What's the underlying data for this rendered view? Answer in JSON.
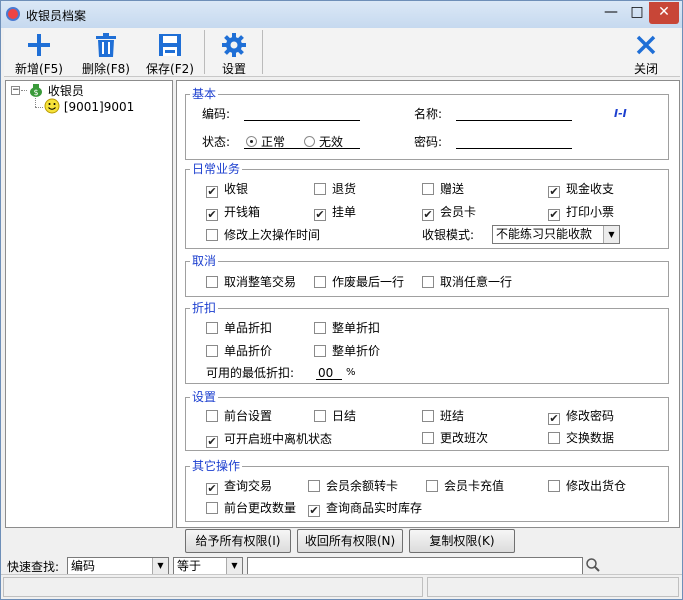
{
  "window": {
    "title": "收银员档案"
  },
  "toolbar": {
    "add_label": "新增(F5)",
    "delete_label": "删除(F8)",
    "save_label": "保存(F2)",
    "settings_label": "设置",
    "close_label": "关闭"
  },
  "tree": {
    "root_label": "收银员",
    "child_label": "[9001]9001"
  },
  "basic": {
    "title": "基本",
    "code_label": "编码:",
    "name_label": "名称:",
    "status_label": "状态:",
    "status_normal": "正常",
    "status_invalid": "无效",
    "password_label": "密码:",
    "marker": "I-I"
  },
  "daily": {
    "title": "日常业务",
    "items": [
      {
        "label": "收银",
        "checked": true
      },
      {
        "label": "退货",
        "checked": false
      },
      {
        "label": "赠送",
        "checked": false
      },
      {
        "label": "现金收支",
        "checked": true
      },
      {
        "label": "开钱箱",
        "checked": true
      },
      {
        "label": "挂单",
        "checked": true
      },
      {
        "label": "会员卡",
        "checked": true
      },
      {
        "label": "打印小票",
        "checked": true
      },
      {
        "label": "修改上次操作时间",
        "checked": false
      }
    ],
    "mode_label": "收银模式:",
    "mode_value": "不能练习只能收款"
  },
  "cancel": {
    "title": "取消",
    "items": [
      {
        "label": "取消整笔交易",
        "checked": false
      },
      {
        "label": "作废最后一行",
        "checked": false
      },
      {
        "label": "取消任意一行",
        "checked": false
      }
    ]
  },
  "discount": {
    "title": "折扣",
    "items": [
      {
        "label": "单品折扣",
        "checked": false
      },
      {
        "label": "整单折扣",
        "checked": false
      },
      {
        "label": "单品折价",
        "checked": false
      },
      {
        "label": "整单折价",
        "checked": false
      }
    ],
    "min_label": "可用的最低折扣:",
    "min_value": "00",
    "min_unit": "%"
  },
  "settings": {
    "title": "设置",
    "items": [
      {
        "label": "前台设置",
        "checked": false
      },
      {
        "label": "日结",
        "checked": false
      },
      {
        "label": "班结",
        "checked": false
      },
      {
        "label": "修改密码",
        "checked": true
      },
      {
        "label": "可开启班中离机状态",
        "checked": true
      },
      {
        "label": "更改班次",
        "checked": false
      },
      {
        "label": "交换数据",
        "checked": false
      }
    ]
  },
  "other": {
    "title": "其它操作",
    "items": [
      {
        "label": "查询交易",
        "checked": true
      },
      {
        "label": "会员余额转卡",
        "checked": false
      },
      {
        "label": "会员卡充值",
        "checked": false
      },
      {
        "label": "修改出货仓",
        "checked": false
      },
      {
        "label": "前台更改数量",
        "checked": false
      },
      {
        "label": "查询商品实时库存",
        "checked": true
      }
    ]
  },
  "actions": {
    "grant_all": "给予所有权限(I)",
    "revoke_all": "收回所有权限(N)",
    "copy": "复制权限(K)"
  },
  "quicksearch": {
    "label": "快速查找:",
    "field_value": "编码",
    "op_value": "等于",
    "query_value": ""
  }
}
